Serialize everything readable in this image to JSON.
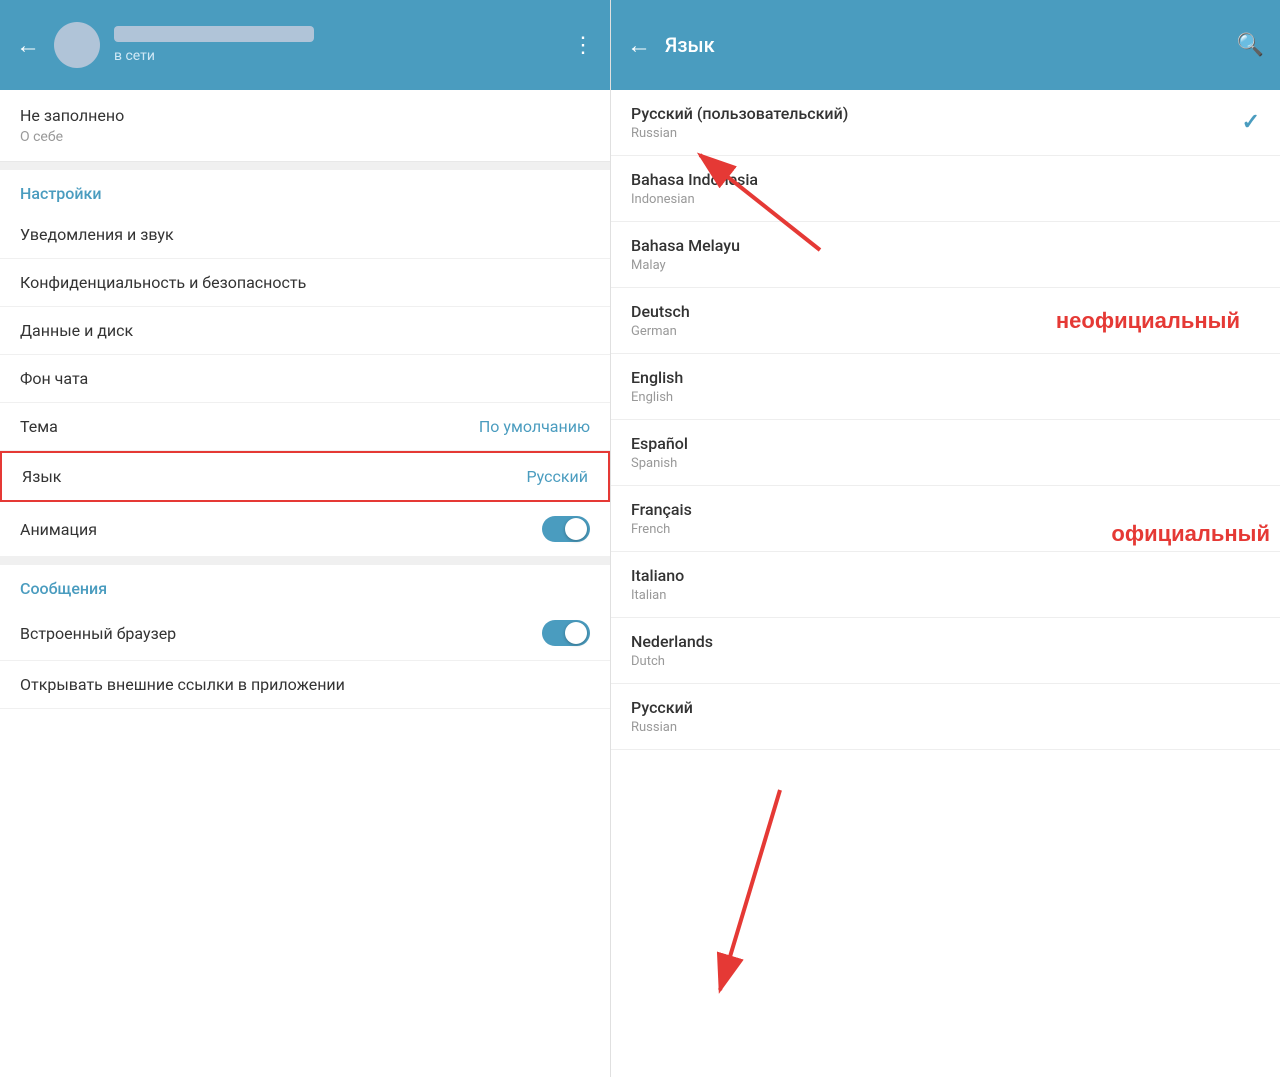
{
  "left": {
    "header": {
      "back_label": "←",
      "status": "в сети",
      "more_label": "⋮"
    },
    "profile": {
      "not_filled": "Не заполнено",
      "about": "О себе"
    },
    "settings_section_label": "Настройки",
    "items": [
      {
        "label": "Уведомления и звук",
        "value": ""
      },
      {
        "label": "Конфиденциальность и безопасность",
        "value": ""
      },
      {
        "label": "Данные и диск",
        "value": ""
      },
      {
        "label": "Фон чата",
        "value": ""
      },
      {
        "label": "Тема",
        "value": "По умолчанию"
      },
      {
        "label": "Язык",
        "value": "Русский",
        "highlighted": true
      },
      {
        "label": "Анимация",
        "toggle": true
      }
    ],
    "messages_section_label": "Сообщения",
    "messages_items": [
      {
        "label": "Встроенный браузер",
        "toggle": true
      },
      {
        "label": "Открывать внешние ссылки в приложении",
        "toggle": true
      }
    ]
  },
  "right": {
    "header": {
      "back_label": "←",
      "title": "Язык",
      "search_icon": "🔍"
    },
    "languages": [
      {
        "name": "Русский (пользовательский)",
        "sub": "Russian",
        "checked": true,
        "annotation": ""
      },
      {
        "name": "Bahasa Indonesia",
        "sub": "Indonesian",
        "annotation": "unofficial",
        "annotation_label": "неофициальный"
      },
      {
        "name": "Bahasa Melayu",
        "sub": "Malay",
        "annotation": ""
      },
      {
        "name": "Deutsch",
        "sub": "German",
        "annotation": ""
      },
      {
        "name": "English",
        "sub": "English",
        "annotation": ""
      },
      {
        "name": "Español",
        "sub": "Spanish",
        "annotation": ""
      },
      {
        "name": "Français",
        "sub": "French",
        "annotation": "official",
        "annotation_label": "официальный"
      },
      {
        "name": "Italiano",
        "sub": "Italian",
        "annotation": ""
      },
      {
        "name": "Nederlands",
        "sub": "Dutch",
        "annotation": ""
      },
      {
        "name": "Русский",
        "sub": "Russian",
        "annotation": ""
      }
    ]
  },
  "annotations": {
    "unofficial_label": "неофициальный",
    "official_label": "официальный"
  }
}
